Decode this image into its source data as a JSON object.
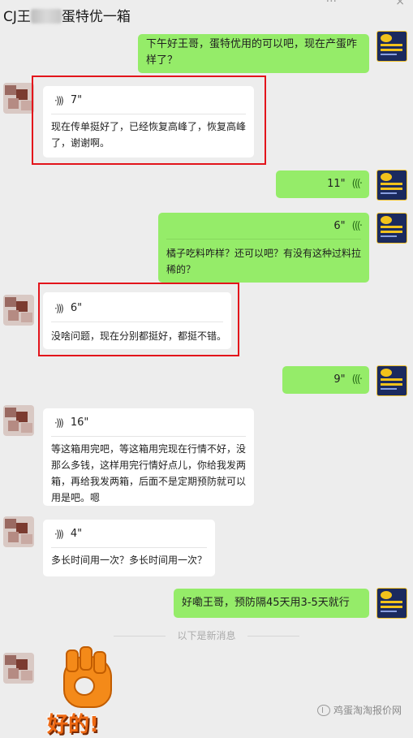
{
  "header": {
    "title_prefix": "CJ王",
    "title_suffix": "蛋特优一箱",
    "menu_glyph": "···",
    "close_glyph": "×"
  },
  "messages": [
    {
      "side": "right",
      "type": "text",
      "text": "下午好王哥，蛋特优用的可以吧，现在产蛋咋样了？"
    },
    {
      "side": "left",
      "type": "voice",
      "duration": "7\"",
      "transcript": "现在传单挺好了，已经恢复高峰了，恢复高峰了，谢谢啊。",
      "highlighted": true
    },
    {
      "side": "right",
      "type": "voice",
      "duration": "11\""
    },
    {
      "side": "right",
      "type": "voice",
      "duration": "6\"",
      "transcript": "橘子吃料咋样？还可以吧？有没有这种过料拉稀的？"
    },
    {
      "side": "left",
      "type": "voice",
      "duration": "6\"",
      "transcript": "没啥问题，现在分别都挺好，都挺不错。",
      "highlighted": true
    },
    {
      "side": "right",
      "type": "voice",
      "duration": "9\""
    },
    {
      "side": "left",
      "type": "voice",
      "duration": "16\"",
      "transcript": "等这箱用完吧，等这箱用完现在行情不好，没那么多钱，这样用完行情好点儿，你给我发两箱，再给我发两箱，后面不是定期预防就可以用是吧。嗯"
    },
    {
      "side": "left",
      "type": "voice",
      "duration": "4\"",
      "transcript": "多长时间用一次？多长时间用一次？"
    },
    {
      "side": "right",
      "type": "text",
      "text": "好嘞王哥，预防隔45天用3-5天就行"
    }
  ],
  "system": {
    "new_messages_divider": "以下是新消息"
  },
  "sticker": {
    "text": "好的!",
    "description_icon": "ok-hand-sticker"
  },
  "watermark": {
    "text": "鸡蛋淘淘报价网"
  },
  "colors": {
    "bubble_green": "#95ec69",
    "bubble_white": "#ffffff",
    "background": "#ededed",
    "highlight_red": "#e3141b"
  }
}
